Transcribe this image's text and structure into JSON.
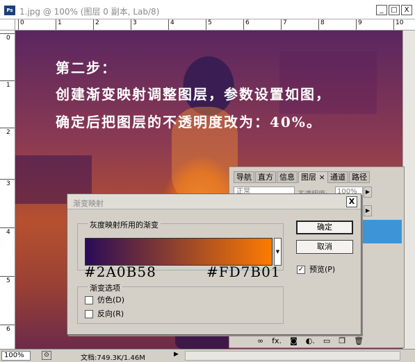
{
  "window": {
    "title": "1.jpg @ 100% (图层 0 副本, Lab/8)",
    "app_icon": "Ps",
    "minimize": "_",
    "maximize": "□",
    "close": "X"
  },
  "rulers": {
    "h_ticks": [
      "0",
      "1",
      "2",
      "3",
      "4",
      "5",
      "6",
      "7",
      "8",
      "9",
      "10"
    ],
    "v_ticks": [
      "0",
      "1",
      "2",
      "3",
      "4",
      "5",
      "6"
    ]
  },
  "canvas_text": {
    "line1": "第二步：",
    "line2": "创建渐变映射调整图层，参数设置如图，",
    "line3": "确定后把图层的不透明度改为：40%。"
  },
  "panel": {
    "tabs": [
      "导航",
      "直方",
      "信息",
      "图层",
      "通道",
      "路径"
    ],
    "active_tab": "图层",
    "tab_close": "×",
    "blend_mode": "正常",
    "opacity_label": "不透明度:",
    "opacity_value": "100%",
    "icons": [
      "link-icon",
      "fx-icon",
      "mask-icon",
      "adjustment-icon",
      "folder-icon",
      "new-layer-icon",
      "trash-icon"
    ]
  },
  "dialog": {
    "title": "渐变映射",
    "close": "X",
    "group1_label": "灰度映射所用的渐变",
    "gradient_start": "#2A0B58",
    "gradient_end": "#FD7B01",
    "label_start": "#2A0B58",
    "label_end": "#FD7B01",
    "group2_label": "渐变选项",
    "dither_label": "仿色(D)",
    "reverse_label": "反向(R)",
    "ok": "确定",
    "cancel": "取消",
    "preview_label": "预览(P)",
    "preview_checked": true
  },
  "status": {
    "zoom": "100%",
    "doc": "文档:749.3K/1.46M"
  }
}
